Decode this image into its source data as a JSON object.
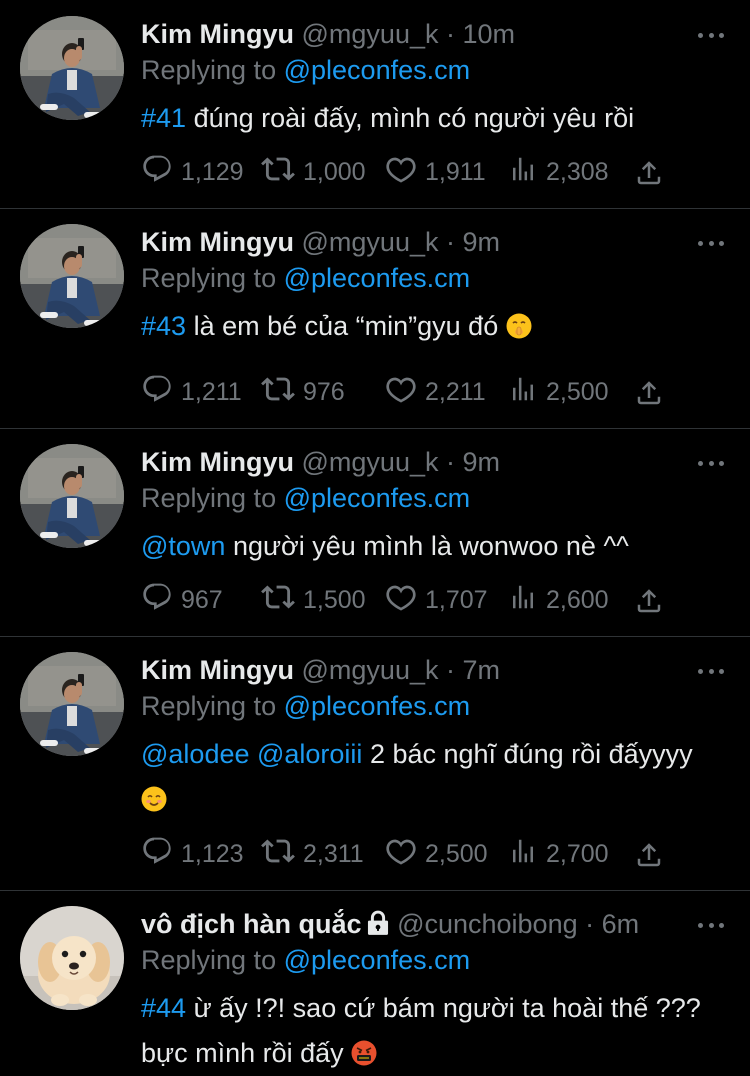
{
  "tweets": [
    {
      "name": "Kim Mingyu",
      "handle": "@mgyuu_k",
      "sep": "·",
      "time": "10m",
      "replying_prefix": "Replying to",
      "replying_to": "@pleconfes.cm",
      "mention": "#41",
      "text": " đúng roài đấy, mình có người yêu rồi",
      "replies": "1,129",
      "retweets": "1,000",
      "likes": "1,911",
      "views": "2,308"
    },
    {
      "name": "Kim Mingyu",
      "handle": "@mgyuu_k",
      "sep": "·",
      "time": "9m",
      "replying_prefix": "Replying to",
      "replying_to": "@pleconfes.cm",
      "mention": "#43",
      "text": " là em bé của “min”gyu đó ",
      "emoji": "shushing-face-emoji",
      "replies": "1,211",
      "retweets": "976",
      "likes": "2,211",
      "views": "2,500"
    },
    {
      "name": "Kim Mingyu",
      "handle": "@mgyuu_k",
      "sep": "·",
      "time": "9m",
      "replying_prefix": "Replying to",
      "replying_to": "@pleconfes.cm",
      "mention": "@town",
      "text": " người yêu mình là wonwoo nè ^^",
      "replies": "967",
      "retweets": "1,500",
      "likes": "1,707",
      "views": "2,600"
    },
    {
      "name": "Kim Mingyu",
      "handle": "@mgyuu_k",
      "sep": "·",
      "time": "7m",
      "replying_prefix": "Replying to",
      "replying_to": "@pleconfes.cm",
      "mention": "@alodee @aloroiii",
      "text": " 2 bác nghĩ đúng rồi đấyyyy ",
      "emoji": "smiling-face-emoji",
      "replies": "1,123",
      "retweets": "2,311",
      "likes": "2,500",
      "views": "2,700"
    },
    {
      "name": "vô địch hàn quắc",
      "handle": "@cunchoibong",
      "sep": "·",
      "time": "6m",
      "protected_icon": "lock-icon",
      "replying_prefix": "Replying to",
      "replying_to": "@pleconfes.cm",
      "mention": "#44",
      "text": " ừ ấy !?! sao cứ bám người ta hoài thế ??? bực mình rồi đấy ",
      "emoji": "cursing-face-emoji"
    }
  ],
  "colors": {
    "background": "#000000",
    "primary_text": "#e7e9ea",
    "secondary_text": "#71767b",
    "link": "#1d9bf0",
    "divider": "#2f3336"
  }
}
